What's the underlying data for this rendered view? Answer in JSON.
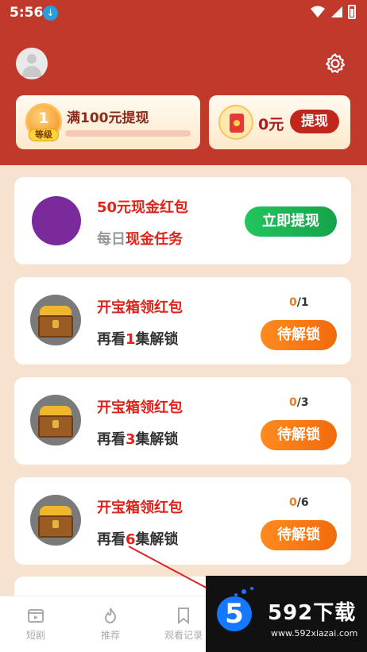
{
  "status": {
    "time": "5:56",
    "download_icon": "download-icon"
  },
  "level_card": {
    "level": "1",
    "level_tag": "等级",
    "text": "满100元提现",
    "progress": 0
  },
  "cash_card": {
    "amount": "0元",
    "button": "提现"
  },
  "promo_card": {
    "title": "50元现金红包",
    "sub_prefix": "每日",
    "sub_highlight": "现金任务",
    "button": "立即提现"
  },
  "tasks": [
    {
      "title": "开宝箱领红包",
      "sub_pre": "再看",
      "num": "1",
      "sub_post": "集解锁",
      "current": "0",
      "total": "/1",
      "button": "待解锁"
    },
    {
      "title": "开宝箱领红包",
      "sub_pre": "再看",
      "num": "3",
      "sub_post": "集解锁",
      "current": "0",
      "total": "/3",
      "button": "待解锁"
    },
    {
      "title": "开宝箱领红包",
      "sub_pre": "再看",
      "num": "6",
      "sub_post": "集解锁",
      "current": "0",
      "total": "/6",
      "button": "待解锁"
    }
  ],
  "nav": [
    {
      "label": "短剧",
      "icon": "video-icon"
    },
    {
      "label": "推荐",
      "icon": "flame-icon"
    },
    {
      "label": "观看记录",
      "icon": "bookmark-icon"
    }
  ],
  "watermark": {
    "logo": "5",
    "title": "592下载",
    "url": "www.592xiazai.com"
  },
  "colors": {
    "header": "#c0392b",
    "accent_red": "#e0231b",
    "green": "#22c55e",
    "orange": "#f26b0c"
  }
}
